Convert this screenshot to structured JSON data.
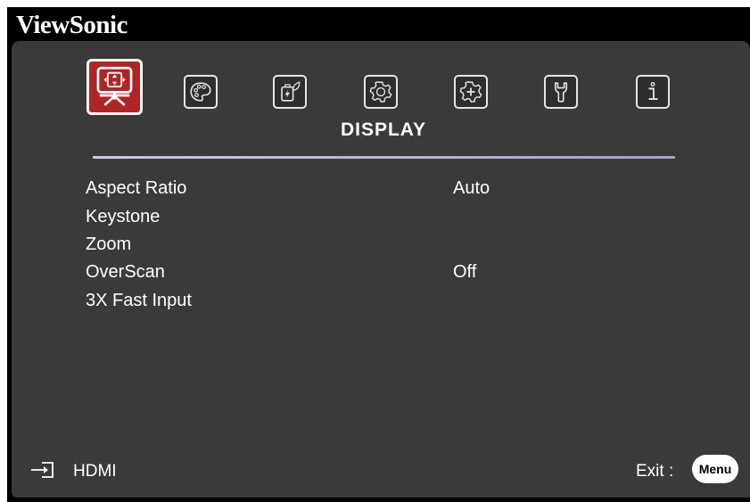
{
  "brand": "ViewSonic",
  "tabs": [
    {
      "icon": "display-icon",
      "active": true
    },
    {
      "icon": "palette-icon",
      "active": false
    },
    {
      "icon": "power-leaf-icon",
      "active": false
    },
    {
      "icon": "basic-gear-icon",
      "active": false
    },
    {
      "icon": "advanced-gear-icon",
      "active": false
    },
    {
      "icon": "wrench-icon",
      "active": false
    },
    {
      "icon": "info-icon",
      "active": false
    }
  ],
  "menu": {
    "title": "DISPLAY",
    "items": [
      {
        "label": "Aspect Ratio",
        "value": "Auto"
      },
      {
        "label": "Keystone",
        "value": ""
      },
      {
        "label": "Zoom",
        "value": ""
      },
      {
        "label": "OverScan",
        "value": "Off"
      },
      {
        "label": "3X Fast Input",
        "value": ""
      }
    ]
  },
  "footer": {
    "source_icon": "input-source-icon",
    "source": "HDMI",
    "exit_label": "Exit :",
    "menu_button": "Menu"
  },
  "colors": {
    "panel": "#3a3a3a",
    "active_tab": "#b12424",
    "divider": "#b6b8d6",
    "text": "#ffffff"
  }
}
